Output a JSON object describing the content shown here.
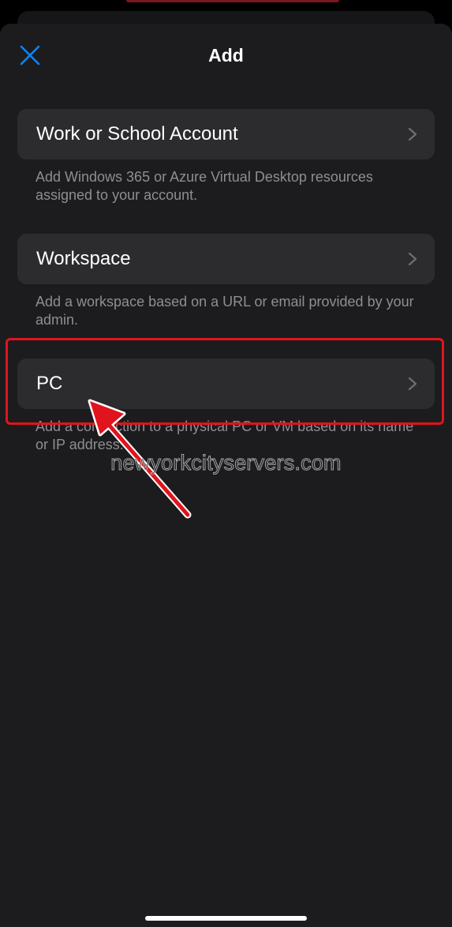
{
  "sheet": {
    "title": "Add",
    "close_icon": "close-icon"
  },
  "options": [
    {
      "label": "Work or School Account",
      "description": "Add Windows 365 or Azure Virtual Desktop resources assigned to your account."
    },
    {
      "label": "Workspace",
      "description": "Add a workspace based on a URL or email provided by your admin."
    },
    {
      "label": "PC",
      "description": "Add a connection to a physical PC or VM based on its name or IP address."
    }
  ],
  "annotation": {
    "watermark": "newyorkcityservers.com",
    "highlight_color": "#e0141c"
  },
  "colors": {
    "accent": "#0a84ff",
    "sheet_background": "#1c1c1e",
    "row_background": "#2c2c2e",
    "secondary_text": "#8e8e93"
  }
}
